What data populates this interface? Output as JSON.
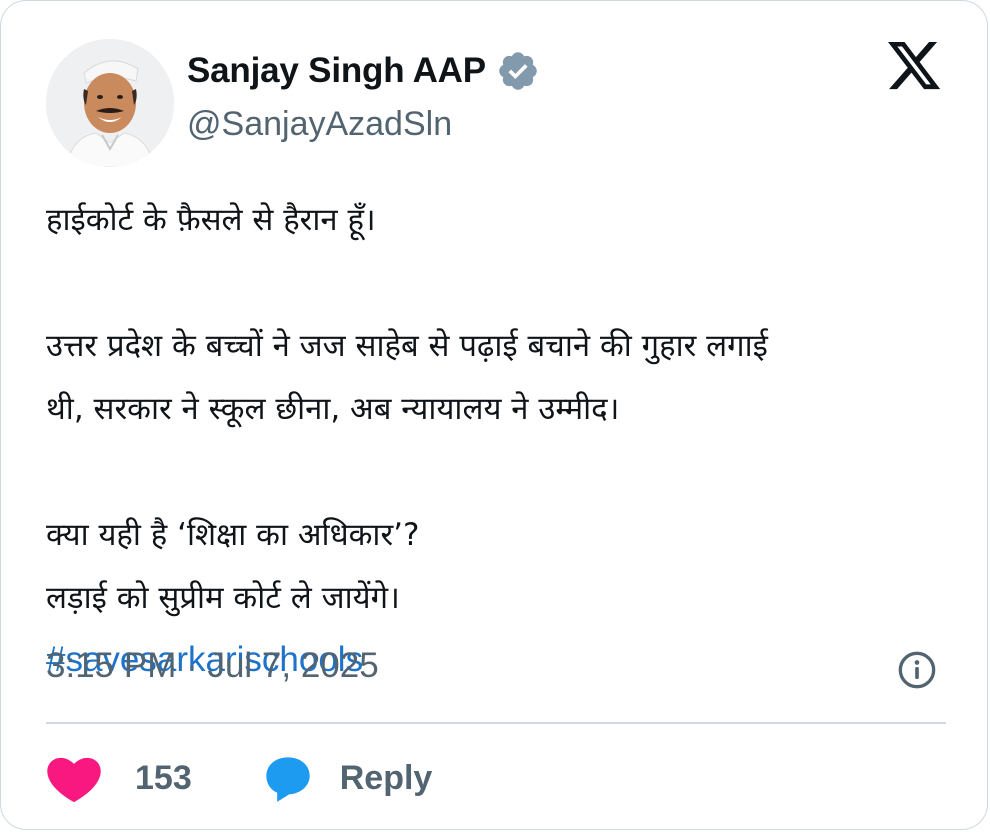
{
  "author": {
    "display_name": "Sanjay Singh AAP",
    "handle": "@SanjayAzadSln",
    "verified": true,
    "avatar_icon": "profile-photo"
  },
  "brand": {
    "logo_icon": "x-logo-icon"
  },
  "tweet": {
    "lines": [
      "हाईकोर्ट के फ़ैसले से हैरान हूँ।",
      "",
      "उत्तर प्रदेश के बच्चों ने जज साहेब से पढ़ाई बचाने की गुहार लगाई",
      "थी, सरकार ने स्कूल छीना, अब न्यायालय ने उम्मीद।",
      "",
      "क्या यही है ‘शिक्षा का अधिकार’?",
      "लड़ाई को सुप्रीम कोर्ट ले जायेंगे।"
    ],
    "hashtag": "#savesarkarischools",
    "timestamp": "3:15 PM · Jul 7, 2025"
  },
  "actions": {
    "like_count": "153",
    "reply_label": "Reply"
  },
  "colors": {
    "verified_badge": "#829aab",
    "hashtag": "#1d73c9",
    "like": "#f91880",
    "reply": "#1d9bf0",
    "secondary_text": "#536471"
  }
}
